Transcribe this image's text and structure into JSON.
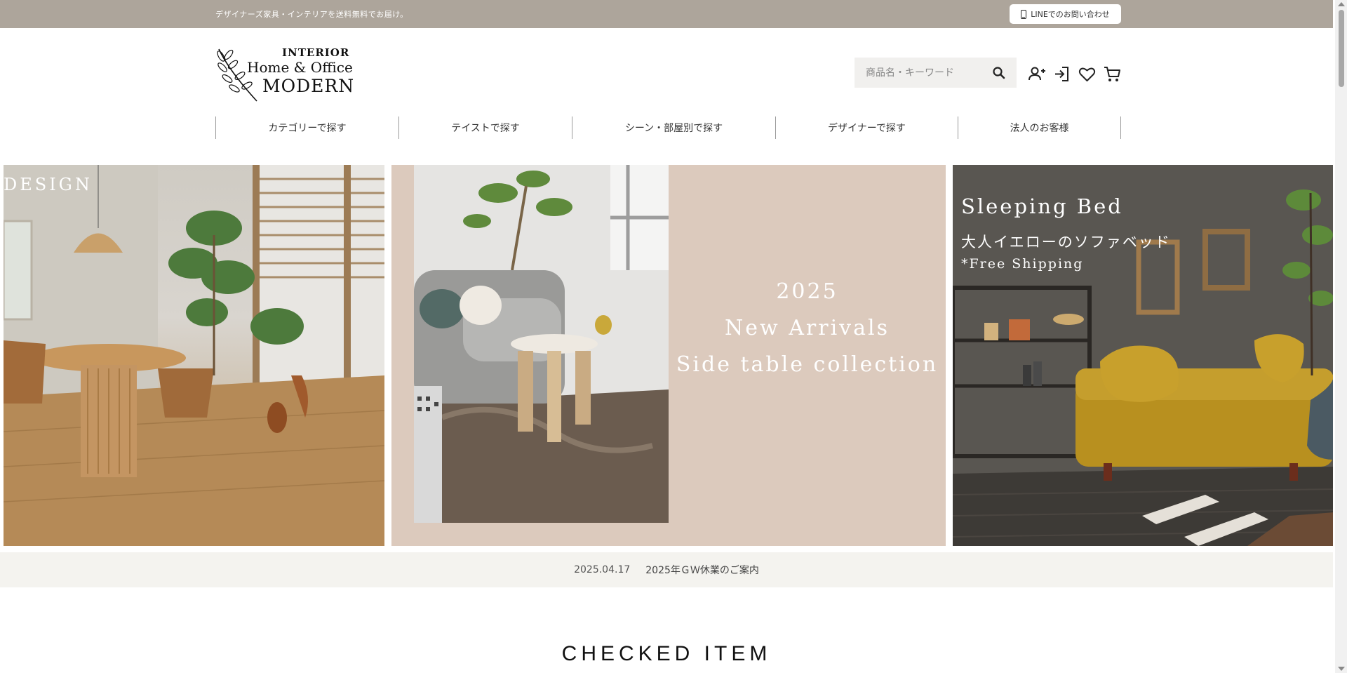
{
  "topbar": {
    "message": "デザイナーズ家具・インテリアを送料無料でお届け。",
    "line_button_label": "LINEでのお問い合わせ",
    "line_button_icon": "smartphone-icon"
  },
  "logo": {
    "line1": "INTERIOR",
    "line2": "Home & Office",
    "line3": "MODERN",
    "emblem_icon": "olive-branch-icon"
  },
  "search": {
    "placeholder": "商品名・キーワード",
    "icon": "search-icon"
  },
  "header_icons": [
    "user-register-icon",
    "login-icon",
    "heart-icon",
    "cart-icon"
  ],
  "nav": {
    "items": [
      {
        "label": "カテゴリーで探す"
      },
      {
        "label": "テイストで探す"
      },
      {
        "label": "シーン・部屋別で探す"
      },
      {
        "label": "デザイナーで探す"
      },
      {
        "label": "法人のお客様"
      }
    ]
  },
  "hero": {
    "slide1": {
      "text": "DESIGN"
    },
    "slide2": {
      "line1": "2025",
      "line2": "New Arrivals",
      "line3": "Side table collection"
    },
    "slide3": {
      "title": "Sleeping Bed",
      "subtitle": "大人イエローのソファベッド",
      "shipping": "*Free Shipping"
    }
  },
  "news": {
    "date": "2025.04.17",
    "title": "2025年ＧＷ休業のご案内"
  },
  "section": {
    "checked_item_title": "CHECKED ITEM"
  },
  "colors": {
    "topbar_bg": "#ada59b",
    "slide2_bg": "#dccabd",
    "sofa_yellow": "#b8901f",
    "newsbar_bg": "#f4f3ef"
  }
}
